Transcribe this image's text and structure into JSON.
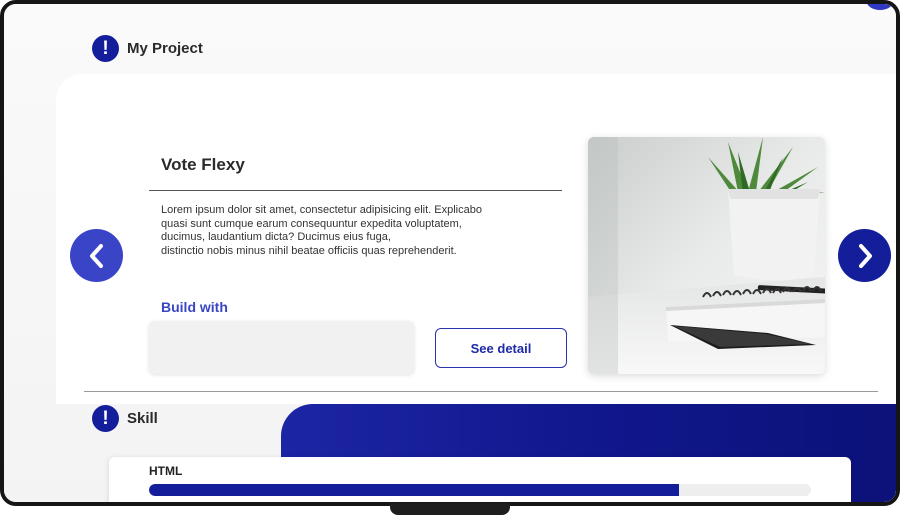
{
  "sections": {
    "project": {
      "title": "My Project",
      "icon": "exclamation-icon"
    },
    "skill": {
      "title": "Skill",
      "icon": "exclamation-icon"
    }
  },
  "project": {
    "title": "Vote Flexy",
    "description_lines": [
      "Lorem ipsum dolor sit amet, consectetur adipisicing elit. Explicabo",
      "quasi sunt cumque earum consequuntur expedita voluptatem,",
      "ducimus, laudantium dicta? Ducimus eius fuga,",
      "distinctio nobis minus nihil beatae officiis quas reprehenderit."
    ],
    "build_label": "Build with",
    "detail_button": "See detail",
    "prev_icon": "chevron-left-icon",
    "next_icon": "chevron-right-icon"
  },
  "skills": [
    {
      "name": "HTML",
      "level": 0.8
    }
  ],
  "colors": {
    "primary_dark": "#141e9a",
    "primary": "#3a44c6",
    "text": "#2b2b2b"
  }
}
